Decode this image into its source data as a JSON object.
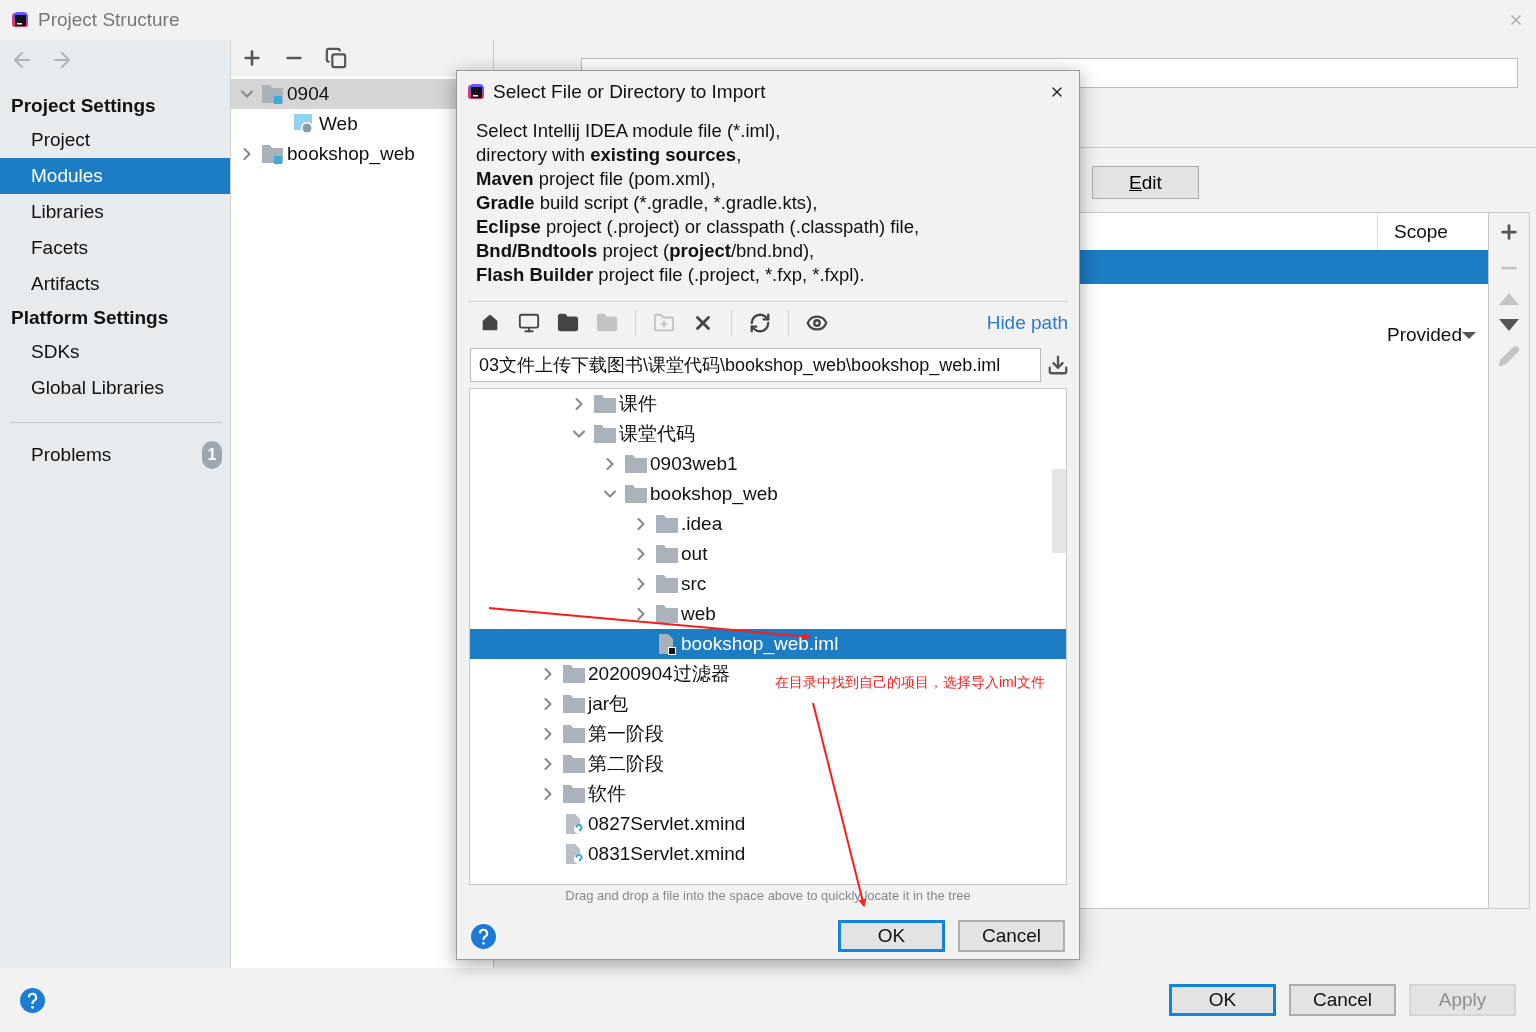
{
  "window": {
    "title": "Project Structure"
  },
  "nav": [
    {
      "kind": "back",
      "disabled": true
    },
    {
      "kind": "forward",
      "disabled": true
    }
  ],
  "sidebar": {
    "sections": [
      {
        "heading": "Project Settings",
        "items": [
          {
            "label": "Project",
            "selected": false
          },
          {
            "label": "Modules",
            "selected": true
          },
          {
            "label": "Libraries",
            "selected": false
          },
          {
            "label": "Facets",
            "selected": false
          },
          {
            "label": "Artifacts",
            "selected": false
          }
        ]
      },
      {
        "heading": "Platform Settings",
        "items": [
          {
            "label": "SDKs",
            "selected": false
          },
          {
            "label": "Global Libraries",
            "selected": false
          }
        ]
      }
    ],
    "problems": {
      "label": "Problems",
      "count": "1"
    }
  },
  "module_toolbar": [
    {
      "kind": "add"
    },
    {
      "kind": "remove"
    },
    {
      "kind": "copy"
    }
  ],
  "module_tree": [
    {
      "label": "0904",
      "kind": "module",
      "expanded": true,
      "selected": true,
      "children": [
        {
          "label": "Web",
          "kind": "web",
          "selected": false
        }
      ]
    },
    {
      "label": "bookshop_web",
      "kind": "module",
      "expanded": false,
      "selected": false
    }
  ],
  "edit_button": {
    "label": "Edit"
  },
  "dependencies": {
    "columns": [
      "Scope"
    ],
    "rows": [
      {
        "selected": true
      },
      {
        "selected": false,
        "scope": "Provided"
      }
    ]
  },
  "table_toolbar": [
    {
      "kind": "add",
      "disabled": false
    },
    {
      "kind": "remove",
      "disabled": true
    },
    {
      "kind": "up",
      "disabled": true
    },
    {
      "kind": "down",
      "disabled": false
    },
    {
      "kind": "edit",
      "disabled": true
    }
  ],
  "buttons": [
    {
      "label": "OK",
      "default": true,
      "disabled": false
    },
    {
      "label": "Cancel",
      "default": false,
      "disabled": false
    },
    {
      "label": "Apply",
      "default": false,
      "disabled": true
    }
  ],
  "dialog": {
    "title": "Select File or Directory to Import",
    "description": [
      "Select Intellij IDEA module file (*.iml),",
      "directory with **existing sources**,",
      "**Maven** project file (pom.xml),",
      "**Gradle** build script (*.gradle, *.gradle.kts),",
      "**Eclipse** project (.project) or classpath (.classpath) file,",
      "**Bnd/Bndtools** project (**project**/bnd.bnd),",
      "**Flash Builder** project file (.project, *.fxp, *.fxpl)."
    ],
    "toolbar": [
      {
        "kind": "home",
        "disabled": false
      },
      {
        "kind": "desktop",
        "disabled": false
      },
      {
        "kind": "project",
        "disabled": false
      },
      {
        "kind": "module",
        "disabled": true
      },
      {
        "kind": "separator"
      },
      {
        "kind": "new-folder",
        "disabled": true
      },
      {
        "kind": "delete",
        "disabled": false
      },
      {
        "kind": "separator"
      },
      {
        "kind": "refresh",
        "disabled": false
      },
      {
        "kind": "separator"
      },
      {
        "kind": "show-hidden",
        "disabled": false
      }
    ],
    "hide_path_link": "Hide path",
    "path": "03文件上传下载图书\\课堂代码\\bookshop_web\\bookshop_web.iml",
    "tree": {
      "scrolled_branch": [
        {
          "label": "课件",
          "kind": "folder",
          "expanded": false,
          "selected": false
        },
        {
          "label": "课堂代码",
          "kind": "folder",
          "expanded": true,
          "selected": false,
          "children": [
            {
              "label": "0903web1",
              "kind": "folder",
              "expanded": false,
              "selected": false
            },
            {
              "label": "bookshop_web",
              "kind": "folder",
              "expanded": true,
              "selected": false,
              "children": [
                {
                  "label": ".idea",
                  "kind": "folder",
                  "expanded": false,
                  "selected": false
                },
                {
                  "label": "out",
                  "kind": "folder",
                  "expanded": false,
                  "selected": false
                },
                {
                  "label": "src",
                  "kind": "folder",
                  "expanded": false,
                  "selected": false
                },
                {
                  "label": "web",
                  "kind": "folder",
                  "expanded": false,
                  "selected": false
                },
                {
                  "label": "bookshop_web.iml",
                  "kind": "module-file",
                  "selected": true
                }
              ]
            }
          ]
        }
      ],
      "items": [
        {
          "label": "20200904过滤器",
          "kind": "folder",
          "expanded": false,
          "selected": false
        },
        {
          "label": "jar包",
          "kind": "folder",
          "expanded": false,
          "selected": false
        },
        {
          "label": "第一阶段",
          "kind": "folder",
          "expanded": false,
          "selected": false
        },
        {
          "label": "第二阶段",
          "kind": "folder",
          "expanded": false,
          "selected": false
        },
        {
          "label": "软件",
          "kind": "folder",
          "expanded": false,
          "selected": false
        },
        {
          "label": "0827Servlet.xmind",
          "kind": "file",
          "selected": false
        },
        {
          "label": "0831Servlet.xmind",
          "kind": "file",
          "selected": false
        }
      ]
    },
    "hint": "Drag and drop a file into the space above to quickly locate it in the tree",
    "buttons": [
      {
        "label": "OK",
        "default": true,
        "disabled": false
      },
      {
        "label": "Cancel",
        "default": false,
        "disabled": false
      }
    ]
  },
  "annotation": {
    "text": "在目录中找到自己的项目，选择导入iml文件"
  }
}
